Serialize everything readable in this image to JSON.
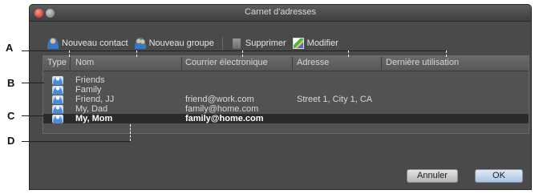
{
  "window": {
    "title": "Carnet d'adresses"
  },
  "toolbar": {
    "new_contact": "Nouveau contact",
    "new_group": "Nouveau groupe",
    "delete": "Supprimer",
    "modify": "Modifier"
  },
  "table": {
    "headers": {
      "type": "Type",
      "name": "Nom",
      "email": "Courrier électronique",
      "address": "Adresse",
      "last_used": "Dernière utilisation"
    },
    "rows": [
      {
        "icon": "group-icon",
        "name": "Friends",
        "email": "",
        "address": ""
      },
      {
        "icon": "group-icon",
        "name": "Family",
        "email": "",
        "address": ""
      },
      {
        "icon": "contact-icon",
        "name": "Friend, JJ",
        "email": "friend@work.com",
        "address": "Street 1, City 1, CA"
      },
      {
        "icon": "contact-icon",
        "name": "My, Dad",
        "email": "family@home.com",
        "address": ""
      },
      {
        "icon": "contact-icon",
        "name": "My, Mom",
        "email": "family@home.com",
        "address": "",
        "selected": true
      }
    ]
  },
  "buttons": {
    "cancel": "Annuler",
    "ok": "OK"
  },
  "callouts": {
    "a": "A",
    "b": "B",
    "c": "C",
    "d": "D"
  }
}
